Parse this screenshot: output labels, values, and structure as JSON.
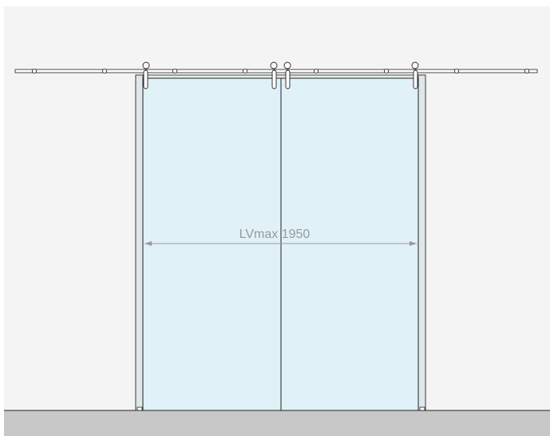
{
  "diagram": {
    "dimension_label": "LVmax 1950"
  },
  "colors": {
    "wall": "#f4f4f4",
    "floor": "#c8c8c8",
    "glass": "#e0f1f8",
    "line": "#222222",
    "dimension": "#9a9a9a",
    "rail": "#ffffff"
  }
}
